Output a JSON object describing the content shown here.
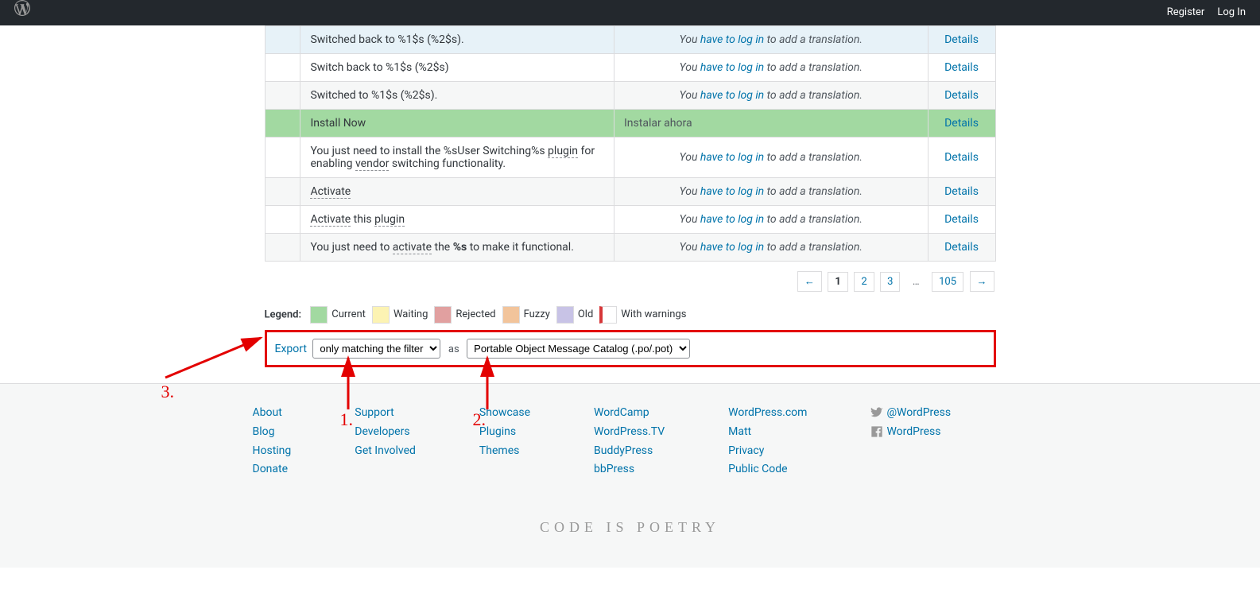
{
  "adminbar": {
    "register": "Register",
    "login": "Log In"
  },
  "table": {
    "rows": [
      {
        "cls": "row-fuzzy",
        "src_html": "Switched back to %1$s (%2$s).",
        "tr_type": "login",
        "details": "Details"
      },
      {
        "cls": "",
        "src_html": "Switch back to %1$s (%2$s)",
        "tr_type": "login",
        "details": "Details"
      },
      {
        "cls": "row-stripe",
        "src_html": "Switched to %1$s (%2$s).",
        "tr_type": "login",
        "details": "Details"
      },
      {
        "cls": "row-current",
        "src_html": "Install Now",
        "tr_type": "text",
        "tr_text": "Instalar ahora",
        "details": "Details"
      },
      {
        "cls": "",
        "src_html": "You just need to install the %sUser Switching%s <span class=\"dotted\">plugin</span> for enabling <span class=\"dotted\">vendor</span> switching functionality.",
        "tr_type": "login",
        "details": "Details"
      },
      {
        "cls": "row-stripe",
        "src_html": "<span class=\"dotted\">Activate</span>",
        "tr_type": "login",
        "details": "Details"
      },
      {
        "cls": "",
        "src_html": "<span class=\"dotted\">Activate</span> this <span class=\"dotted\">plugin</span>",
        "tr_type": "login",
        "details": "Details"
      },
      {
        "cls": "row-stripe",
        "src_html": "You just need to <span class=\"dotted\">activate</span> the <strong>%s</strong> to make it functional.",
        "tr_type": "login",
        "details": "Details"
      }
    ],
    "login_prefix": "You ",
    "login_link": "have to log in",
    "login_suffix": " to add a translation."
  },
  "paging": {
    "prev": "←",
    "current": "1",
    "pages": [
      "2",
      "3"
    ],
    "dots": "…",
    "last": "105",
    "next": "→"
  },
  "legend": {
    "label": "Legend:",
    "items": [
      {
        "cls": "sw-current",
        "text": "Current"
      },
      {
        "cls": "sw-waiting",
        "text": "Waiting"
      },
      {
        "cls": "sw-rejected",
        "text": "Rejected"
      },
      {
        "cls": "sw-fuzzy",
        "text": "Fuzzy"
      },
      {
        "cls": "sw-old",
        "text": "Old"
      },
      {
        "cls": "sw-warn",
        "text": "With warnings"
      }
    ]
  },
  "export": {
    "link": "Export",
    "scope": "only matching the filter",
    "as": "as",
    "format": "Portable Object Message Catalog (.po/.pot)"
  },
  "footer": {
    "cols": [
      [
        "About",
        "Blog",
        "Hosting",
        "Donate"
      ],
      [
        "Support",
        "Developers",
        "Get Involved"
      ],
      [
        "Showcase",
        "Plugins",
        "Themes"
      ],
      [
        "WordCamp",
        "WordPress.TV",
        "BuddyPress",
        "bbPress"
      ],
      [
        "WordPress.com",
        "Matt",
        "Privacy",
        "Public Code"
      ]
    ],
    "social": [
      {
        "name": "twitter",
        "text": "@WordPress"
      },
      {
        "name": "facebook",
        "text": "WordPress"
      }
    ],
    "tagline": "Code is Poetry"
  },
  "annotations": {
    "a1": "1.",
    "a2": "2.",
    "a3": "3."
  }
}
